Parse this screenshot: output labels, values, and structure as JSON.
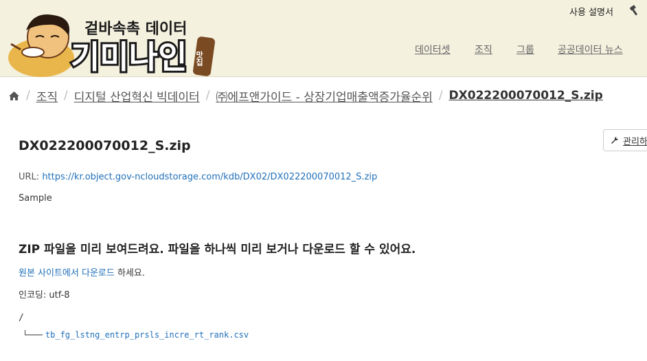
{
  "brand": {
    "tagline": "겉바속촉 데이터",
    "name": "기미나인",
    "badge": "맛집"
  },
  "header": {
    "manual_label": "사용 설명서",
    "nav": [
      "데이터셋",
      "조직",
      "그룹",
      "공공데이터 뉴스"
    ]
  },
  "breadcrumb": {
    "items": [
      "조직",
      "디지털 산업혁신 빅데이터",
      "㈜에프앤가이드 - 상장기업매출액증가율순위",
      "DX022200070012_S.zip"
    ]
  },
  "actions": {
    "manage_label": "관리하기"
  },
  "resource": {
    "title": "DX022200070012_S.zip",
    "url_label": "URL:",
    "url": "https://kr.object.gov-ncloudstorage.com/kdb/DX02/DX022200070012_S.zip",
    "description": "Sample"
  },
  "preview": {
    "heading": "ZIP 파일을 미리 보여드려요. 파일을 하나씩 미리 보거나 다운로드 할 수 있어요.",
    "download_link": "원본 사이트에서 다운로드",
    "download_suffix": " 하세요.",
    "encoding_label": "인코딩:",
    "encoding_value": "utf-8",
    "tree_root": "/",
    "tree_branch": "└───",
    "files": [
      "tb_fg_lstng_entrp_prsls_incre_rt_rank.csv"
    ]
  },
  "colors": {
    "header_bg": "#f4f1df",
    "link": "#1f6fb8",
    "logo_dark": "#1a1a1a",
    "badge_brown": "#7a4a22"
  }
}
